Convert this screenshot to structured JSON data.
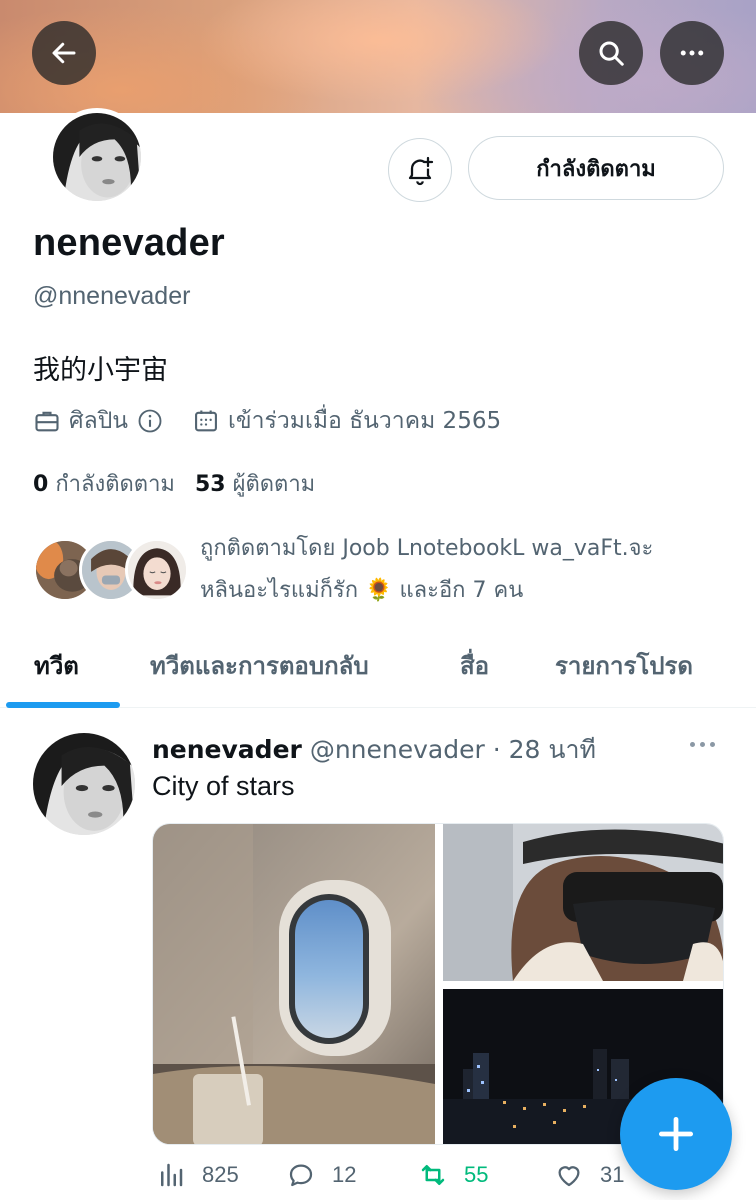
{
  "profile": {
    "display_name": "nenevader",
    "handle": "@nnenevader",
    "bio": "我的小宇宙",
    "category": "ศิลปิน",
    "joined": "เข้าร่วมเมื่อ ธันวาคม 2565",
    "following_count": "0",
    "following_label": "กำลังติดตาม",
    "followers_count": "53",
    "followers_label": "ผู้ติดตาม",
    "followed_by_line1": "ถูกติดตามโดย Joob LnotebookL wa_vaFt.จะ",
    "followed_by_line2a": "หลินอะไรแม่ก็รัก",
    "followed_by_emoji": "🌻",
    "followed_by_line2b": "และอีก 7 คน"
  },
  "header": {
    "following_button": "กำลังติดตาม"
  },
  "tabs": [
    {
      "label": "ทวีต",
      "active": true
    },
    {
      "label": "ทวีตและการตอบกลับ",
      "active": false
    },
    {
      "label": "สื่อ",
      "active": false
    },
    {
      "label": "รายการโปรด",
      "active": false
    }
  ],
  "tweet": {
    "name": "nenevader",
    "handle": "@nnenevader",
    "separator": "·",
    "time": "28 นาที",
    "text": "City of stars",
    "views": "825",
    "replies": "12",
    "retweets": "55",
    "likes": "31"
  },
  "colors": {
    "accent": "#1d9bf0",
    "retweet": "#00ba7c",
    "secondary_text": "#536471"
  },
  "icons": {
    "back": "arrow-left-icon",
    "search": "search-icon",
    "more": "more-horizontal-icon",
    "notify": "bell-plus-icon",
    "category": "briefcase-icon",
    "info": "info-icon",
    "joined": "calendar-icon",
    "compose": "plus-icon"
  }
}
